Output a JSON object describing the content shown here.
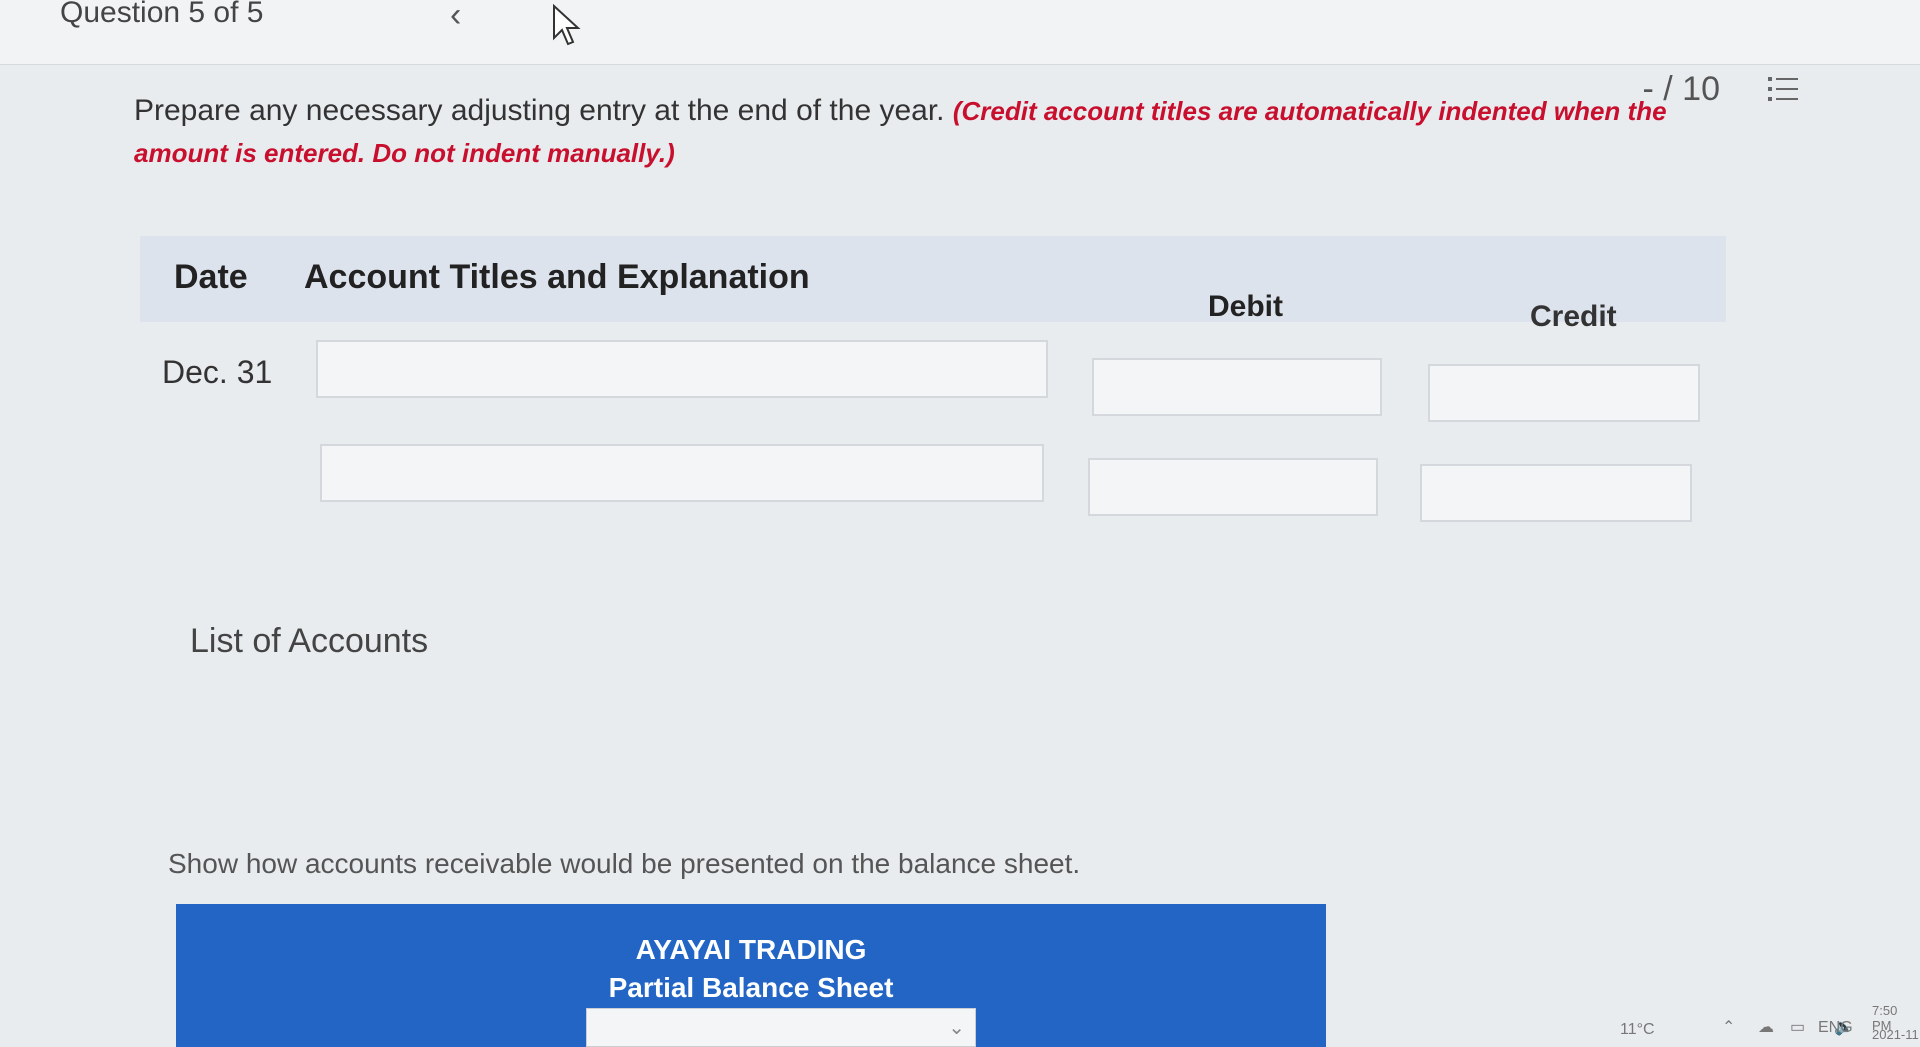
{
  "topbar": {
    "question_label": "Question 5 of 5",
    "prev_glyph": "‹",
    "page_count": "- / 10",
    "list_icon": "list-icon",
    "cursor_icon": "mouse-pointer-icon"
  },
  "instructions": {
    "main": "Prepare any necessary adjusting entry at the end of the year.",
    "note": "(Credit account titles are automatically indented when the amount is entered. Do not indent manually.)"
  },
  "journal": {
    "headers": {
      "date": "Date",
      "account": "Account Titles and Explanation",
      "debit": "Debit",
      "credit": "Credit"
    },
    "rows": [
      {
        "date": "Dec. 31",
        "account": "",
        "debit": "",
        "credit": ""
      },
      {
        "date": "",
        "account": "",
        "debit": "",
        "credit": ""
      }
    ]
  },
  "list_of_accounts": "List of Accounts",
  "prompt2": "Show how accounts receivable would be presented on the balance sheet.",
  "balance_sheet": {
    "company": "AYAYAI TRADING",
    "title": "Partial Balance Sheet",
    "select_value": ""
  },
  "taskbar": {
    "temperature": "11°C",
    "language": "ENG",
    "time": "7:50 PM",
    "date": "2021-11"
  },
  "colors": {
    "accent_blue": "#2265c4",
    "note_red": "#c8102e",
    "header_bg": "#dde3ec"
  }
}
